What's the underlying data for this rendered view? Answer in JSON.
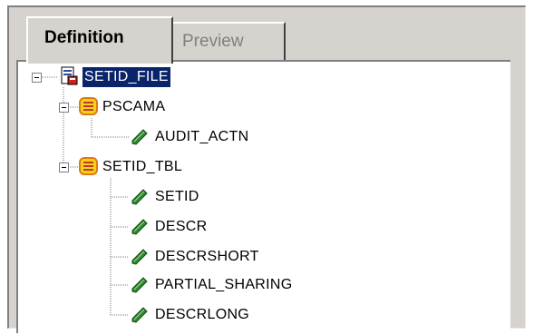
{
  "tabs": [
    {
      "label": "Definition",
      "active": true
    },
    {
      "label": "Preview",
      "active": false
    }
  ],
  "tree": {
    "root": {
      "label": "SETID_FILE",
      "icon": "file-layout-icon",
      "selected": true
    },
    "groups": [
      {
        "label": "PSCAMA",
        "icon": "record-icon",
        "fields": [
          "AUDIT_ACTN"
        ]
      },
      {
        "label": "SETID_TBL",
        "icon": "record-icon",
        "fields": [
          "SETID",
          "DESCR",
          "DESCRSHORT",
          "PARTIAL_SHARING",
          "DESCRLONG"
        ]
      }
    ],
    "field_icon": "field-pencil-icon"
  },
  "colors": {
    "window_bg": "#d6d3ce",
    "selection_bg": "#0a246a",
    "field_icon_green": "#2f8a2f",
    "record_icon_yellow": "#f5d21a",
    "record_icon_orange": "#e07a10"
  }
}
